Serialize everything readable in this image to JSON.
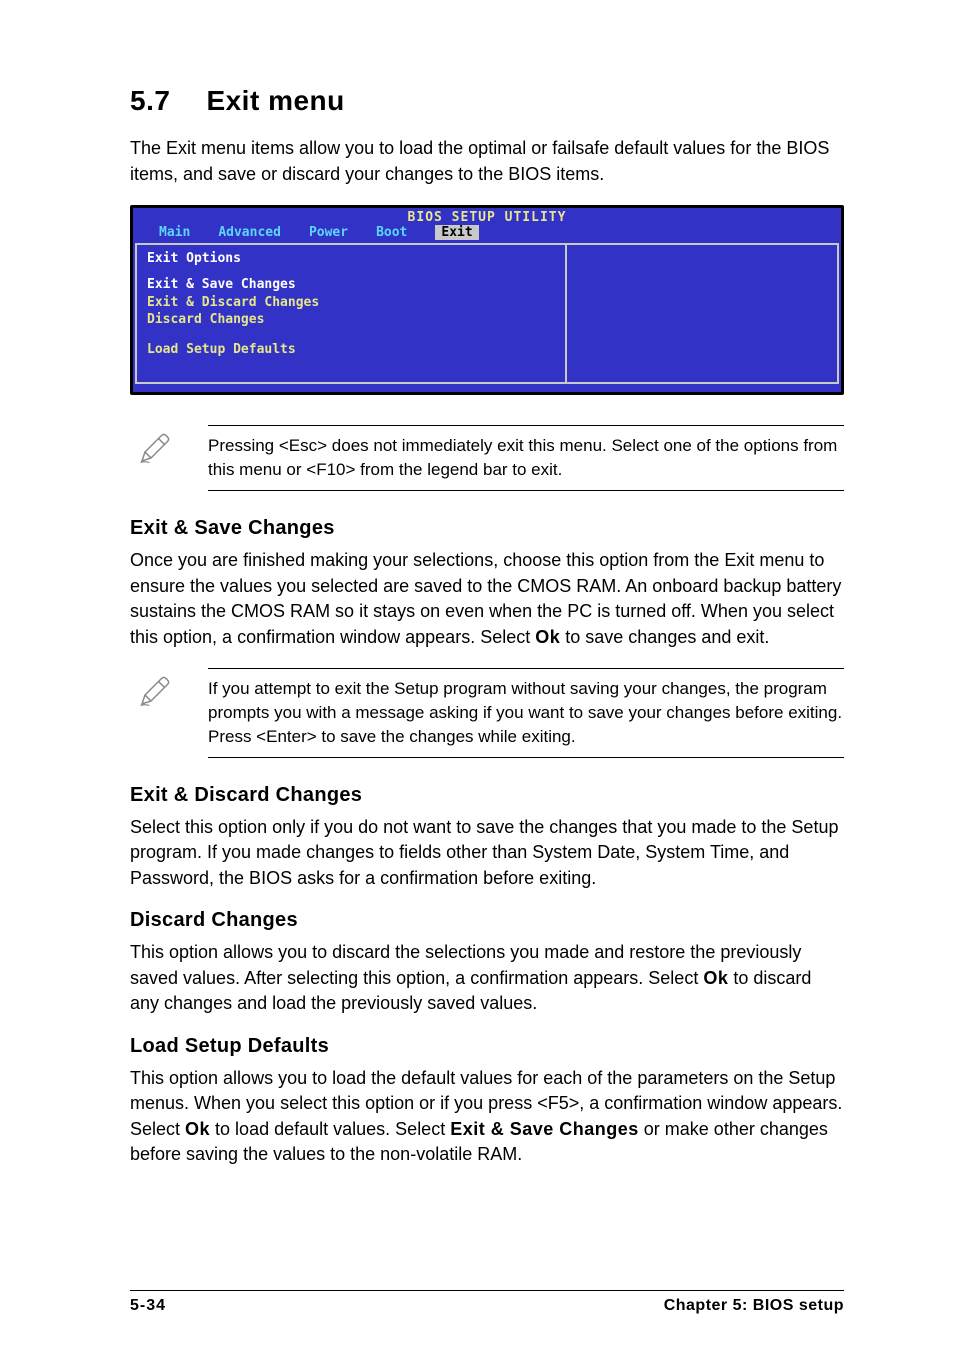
{
  "section": {
    "number": "5.7",
    "title": "Exit menu"
  },
  "intro": "The Exit menu items allow you to load the optimal or failsafe default values for the BIOS items, and save or discard your changes to the BIOS items.",
  "bios": {
    "title": "BIOS SETUP UTILITY",
    "tabs": [
      "Main",
      "Advanced",
      "Power",
      "Boot",
      "Exit"
    ],
    "heading": "Exit Options",
    "group1": [
      "Exit & Save Changes",
      "Exit & Discard Changes",
      "Discard Changes"
    ],
    "group2": [
      "Load Setup Defaults"
    ]
  },
  "note1": "Pressing <Esc> does not immediately exit this menu. Select one of the options from this menu or <F10> from the legend bar to exit.",
  "sections": {
    "save": {
      "heading": "Exit & Save Changes",
      "body_pre": "Once you are finished making your selections, choose this option from the Exit menu to ensure the values you selected are saved to the CMOS RAM. An onboard backup battery sustains the CMOS RAM so it stays on even when the PC is turned off. When you select this option, a confirmation window appears. Select ",
      "body_ok": "Ok",
      "body_post": " to save changes and exit."
    },
    "note2": "If you attempt to exit the Setup program without saving your changes, the program prompts you with a message asking if you want to save your changes before exiting. Press <Enter>  to save the  changes while exiting.",
    "discard_exit": {
      "heading": "Exit & Discard Changes",
      "body": "Select this option only if you do not want to save the changes that you made to the Setup program. If you made changes to fields other than System Date, System Time, and Password, the BIOS asks for a confirmation before exiting."
    },
    "discard": {
      "heading": "Discard Changes",
      "body_pre": "This option allows you to discard the selections you made and restore the previously saved values. After selecting this option, a confirmation appears. Select ",
      "body_ok": "Ok",
      "body_post": " to discard any changes and load the previously saved values."
    },
    "defaults": {
      "heading": "Load Setup Defaults",
      "body_pre": "This option allows you to load the default values for each of the parameters on the Setup menus. When you select this option or if you press <F5>, a confirmation window appears. Select ",
      "body_ok": "Ok",
      "body_mid": " to load default values. Select ",
      "body_bold": "Exit & Save Changes",
      "body_post": " or make other changes before saving the values to the non-volatile RAM."
    }
  },
  "footer": {
    "left": "5-34",
    "right": "Chapter 5: BIOS setup"
  }
}
